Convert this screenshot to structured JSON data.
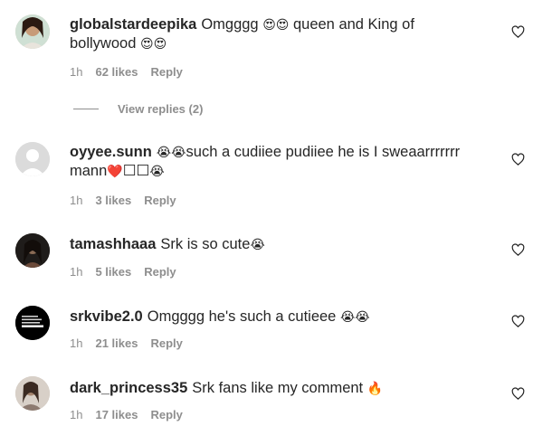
{
  "comments": [
    {
      "username": "globalstardeepika",
      "text_parts": [
        "Omgggg ",
        "😍😍",
        " queen and King of bollywood ",
        "😍😍"
      ],
      "time": "1h",
      "likes": "62 likes",
      "reply": "Reply",
      "avatar": "profile-photo-woman-smiling",
      "view_replies": "View replies (2)"
    },
    {
      "username": "oyyee.sunn",
      "text_parts": [
        "😭😭",
        "such a cudiiee pudiiee he is I sweaarrrrrrr mann",
        "❤️",
        "☐☐",
        "😭"
      ],
      "time": "1h",
      "likes": "3 likes",
      "reply": "Reply",
      "avatar": "default-grey-avatar"
    },
    {
      "username": "tamashhaaa",
      "text_parts": [
        "Srk is so cute",
        "😭"
      ],
      "time": "1h",
      "likes": "5 likes",
      "reply": "Reply",
      "avatar": "profile-photo-dark"
    },
    {
      "username": "srkvibe2.0",
      "text_parts": [
        "Omgggg he's such a cutieee ",
        "😭😭"
      ],
      "time": "1h",
      "likes": "21 likes",
      "reply": "Reply",
      "avatar": "black-text-logo",
      "avatar_text": "There is only one religion in the world HARD WORK"
    },
    {
      "username": "dark_princess35",
      "text_parts": [
        "Srk fans like my comment ",
        "🔥"
      ],
      "time": "1h",
      "likes": "17 likes",
      "reply": "Reply",
      "avatar": "profile-photo-light"
    }
  ],
  "colors": {
    "text": "#262626",
    "meta": "#8e8e8e",
    "background": "#ffffff"
  },
  "icons": {
    "like": "heart-outline-icon"
  }
}
